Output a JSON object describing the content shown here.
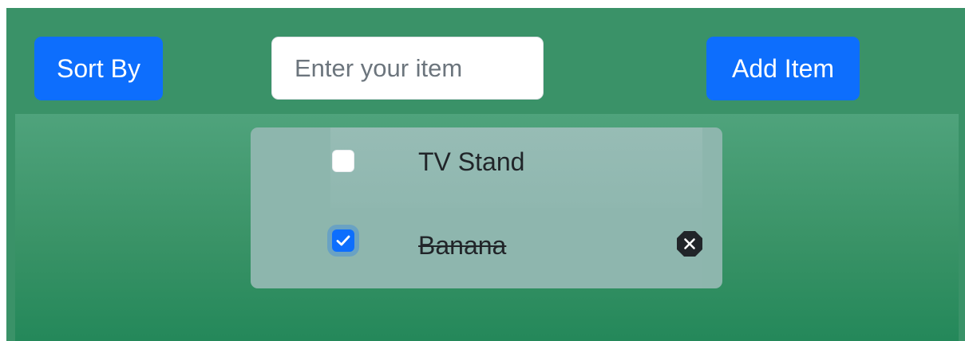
{
  "toolbar": {
    "sort_label": "Sort By",
    "add_label": "Add Item",
    "input_placeholder": "Enter your item",
    "input_value": ""
  },
  "list": {
    "items": [
      {
        "label": "TV Stand",
        "checked": false
      },
      {
        "label": "Banana",
        "checked": true
      }
    ]
  },
  "icons": {
    "check": "check-icon",
    "remove": "x-octagon-icon"
  },
  "colors": {
    "background": "#3a9268",
    "button": "#0d6efd",
    "card": "#8db6ad",
    "text": "#212529"
  }
}
